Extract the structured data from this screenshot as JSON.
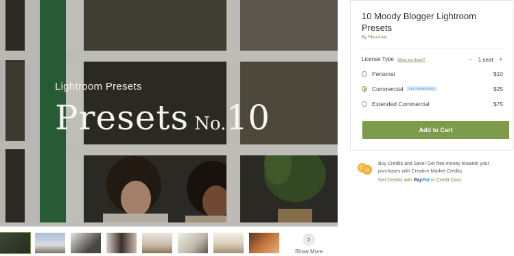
{
  "hero": {
    "subtitle": "Lightroom Presets",
    "title_main": "Presets",
    "title_no": "No.",
    "title_num": "10"
  },
  "thumbnails": [
    "preview-1",
    "preview-2",
    "preview-3",
    "preview-4",
    "preview-5",
    "preview-6",
    "preview-7",
    "preview-8"
  ],
  "show_more": {
    "label": "Show More",
    "icon": "chevron-right-icon"
  },
  "product": {
    "title": "10 Moody Blogger Lightroom Presets",
    "by": "By",
    "author": "Fibra Anas"
  },
  "license": {
    "label": "License Type",
    "what_link": "What are these?",
    "seat_minus": "−",
    "seat_value": "1 seat",
    "seat_plus": "+",
    "options": [
      {
        "name": "Personal",
        "price": "$10",
        "selected": false
      },
      {
        "name": "Commercial",
        "badge": "RECOMMENDED",
        "price": "$25",
        "selected": true
      },
      {
        "name": "Extended Commercial",
        "price": "$75",
        "selected": false
      }
    ]
  },
  "cart_button": "Add to Cart",
  "credits": {
    "text": "Buy Credits and Save! Get free money towards your purchases with Creative Market Credits.",
    "link_prefix": "Get Credits with",
    "paypal_pay": "Pay",
    "paypal_pal": "Pal",
    "link_suffix": "or Credit Card"
  },
  "colors": {
    "accent": "#7e9a4b",
    "badge_bg": "#dfeefa",
    "badge_text": "#4d8fc6"
  }
}
